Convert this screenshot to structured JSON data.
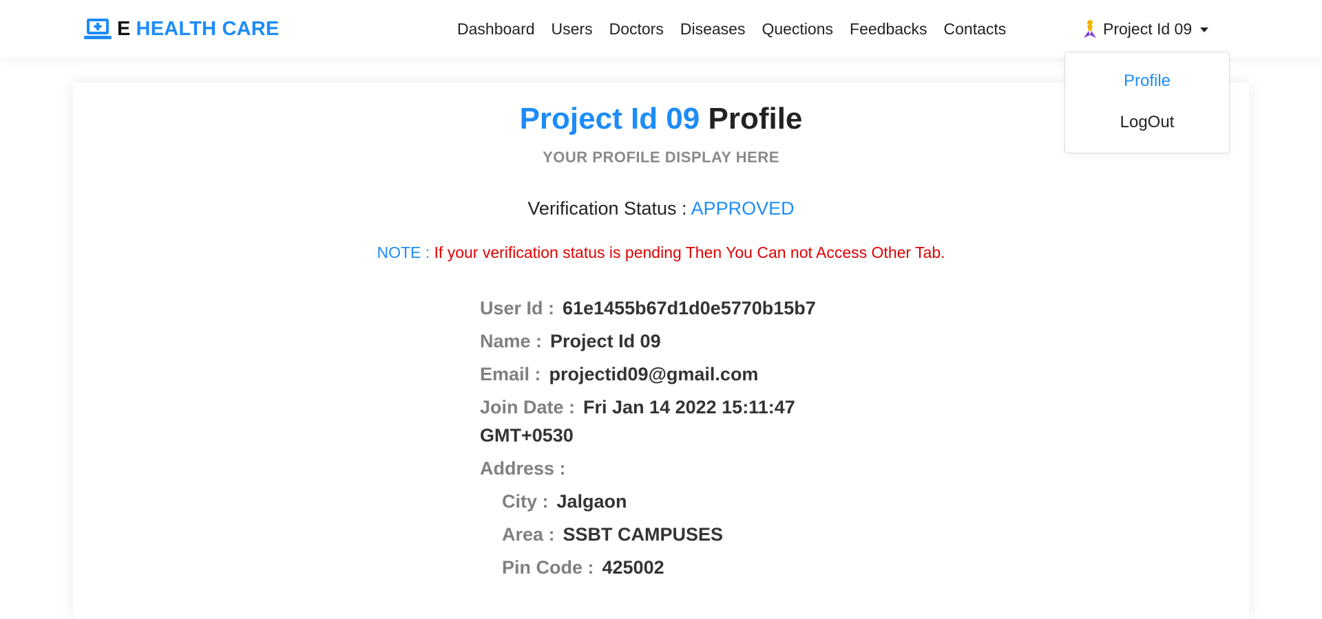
{
  "brand": {
    "prefix": "E",
    "name": "HEALTH CARE"
  },
  "nav": [
    "Dashboard",
    "Users",
    "Doctors",
    "Diseases",
    "Quections",
    "Feedbacks",
    "Contacts"
  ],
  "user_menu": {
    "name": "Project Id 09",
    "items": [
      "Profile",
      "LogOut"
    ]
  },
  "profile": {
    "title_name": "Project Id 09",
    "title_suffix": "Profile",
    "subtitle": "YOUR PROFILE DISPLAY HERE",
    "status_label": "Verification Status :",
    "status_value": "APPROVED",
    "note_label": "NOTE :",
    "note_text": "If your verification status is pending Then You Can not Access Other Tab.",
    "fields": {
      "user_id": {
        "label": "User Id :",
        "value": "61e1455b67d1d0e5770b15b7"
      },
      "name": {
        "label": "Name :",
        "value": "Project Id 09"
      },
      "email": {
        "label": "Email :",
        "value": "projectid09@gmail.com"
      },
      "join_date": {
        "label": "Join Date :",
        "value": "Fri Jan 14 2022 15:11:47 GMT+0530"
      },
      "address": {
        "label": "Address :"
      },
      "city": {
        "label": "City :",
        "value": "Jalgaon"
      },
      "area": {
        "label": "Area :",
        "value": "SSBT CAMPUSES"
      },
      "pin": {
        "label": "Pin Code :",
        "value": "425002"
      }
    }
  },
  "colors": {
    "accent": "#1d8cf8",
    "danger": "#e00000",
    "muted": "#808080"
  }
}
